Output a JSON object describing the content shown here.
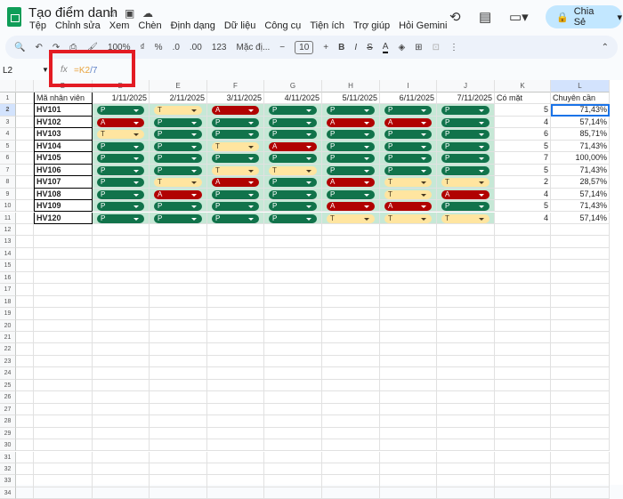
{
  "app": {
    "title": "Tạo điểm danh",
    "share_label": "Chia Sẻ"
  },
  "menu": [
    "Tệp",
    "Chỉnh sửa",
    "Xem",
    "Chèn",
    "Định dạng",
    "Dữ liệu",
    "Công cụ",
    "Tiện ích",
    "Trợ giúp",
    "Hỏi Gemini"
  ],
  "toolbar": {
    "zoom": "100%",
    "currency": "₫",
    "percent": "%",
    "dec_less": ".0",
    "dec_more": ".00",
    "number_format": "123",
    "font": "Mặc đị...",
    "font_size": "10"
  },
  "formula_bar": {
    "name_box": "L2",
    "fx": "fx",
    "formula_ref": "=K2",
    "formula_rest": "/7"
  },
  "columns": [
    "",
    "B",
    "D",
    "E",
    "F",
    "G",
    "H",
    "I",
    "J",
    "K",
    "L"
  ],
  "header_row": [
    "",
    "Mã nhân viên",
    "1/11/2025",
    "2/11/2025",
    "3/11/2025",
    "4/11/2025",
    "5/11/2025",
    "6/11/2025",
    "7/11/2025",
    "Có mặt",
    "Chuyên cần"
  ],
  "rows": [
    {
      "id": "HV101",
      "marks": [
        "P",
        "T",
        "A",
        "P",
        "P",
        "P",
        "P"
      ],
      "present": "5",
      "rate": "71,43%"
    },
    {
      "id": "HV102",
      "marks": [
        "A",
        "P",
        "P",
        "P",
        "A",
        "A",
        "P"
      ],
      "present": "4",
      "rate": "57,14%"
    },
    {
      "id": "HV103",
      "marks": [
        "T",
        "P",
        "P",
        "P",
        "P",
        "P",
        "P"
      ],
      "present": "6",
      "rate": "85,71%"
    },
    {
      "id": "HV104",
      "marks": [
        "P",
        "P",
        "T",
        "A",
        "P",
        "P",
        "P"
      ],
      "present": "5",
      "rate": "71,43%"
    },
    {
      "id": "HV105",
      "marks": [
        "P",
        "P",
        "P",
        "P",
        "P",
        "P",
        "P"
      ],
      "present": "7",
      "rate": "100,00%"
    },
    {
      "id": "HV106",
      "marks": [
        "P",
        "P",
        "T",
        "T",
        "P",
        "P",
        "P"
      ],
      "present": "5",
      "rate": "71,43%"
    },
    {
      "id": "HV107",
      "marks": [
        "P",
        "T",
        "A",
        "P",
        "A",
        "T",
        "T"
      ],
      "present": "2",
      "rate": "28,57%"
    },
    {
      "id": "HV108",
      "marks": [
        "P",
        "A",
        "P",
        "P",
        "P",
        "T",
        "A"
      ],
      "present": "4",
      "rate": "57,14%"
    },
    {
      "id": "HV109",
      "marks": [
        "P",
        "P",
        "P",
        "P",
        "A",
        "A",
        "P"
      ],
      "present": "5",
      "rate": "71,43%"
    },
    {
      "id": "HV120",
      "marks": [
        "P",
        "P",
        "P",
        "P",
        "T",
        "T",
        "T"
      ],
      "present": "4",
      "rate": "57,14%"
    }
  ],
  "colors": {
    "present": "#11734b",
    "absent": "#b10202",
    "late": "#ffe5a0",
    "highlight": "#e31b23"
  }
}
